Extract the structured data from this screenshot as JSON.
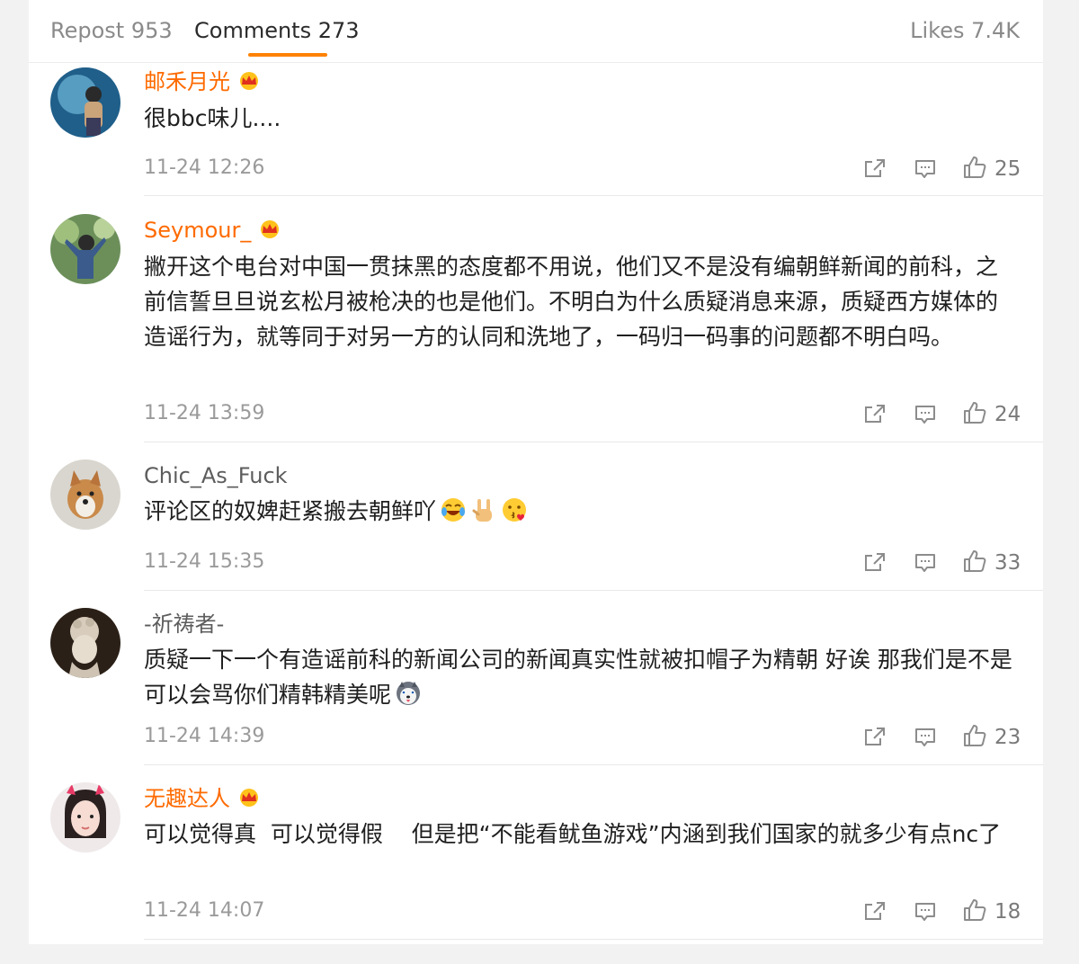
{
  "tabs": {
    "repost": "Repost 953",
    "comments": "Comments 273",
    "likes": "Likes 7.4K"
  },
  "colors": {
    "accent": "#ff8200",
    "vip_name": "#ff6a00",
    "plain_name": "#5d5d5d",
    "meta": "#9a9a9a"
  },
  "icons": {
    "share": "share-icon",
    "reply": "comment-icon",
    "like": "thumbs-up-icon",
    "badge": "vip-crown-icon"
  },
  "comments": [
    {
      "user": "邮禾月光",
      "vip": true,
      "text": "很bbc味儿....",
      "time": "11-24 12:26",
      "likes": "25"
    },
    {
      "user": "Seymour_",
      "vip": true,
      "text": "撇开这个电台对中国一贯抹黑的态度都不用说，他们又不是没有编朝鲜新闻的前科，之前信誓旦旦说玄松月被枪决的也是他们。不明白为什么质疑消息来源，质疑西方媒体的造谣行为，就等同于对另一方的认同和洗地了，一码归一码事的问题都不明白吗。",
      "time": "11-24 13:59",
      "likes": "24"
    },
    {
      "user": "Chic_As_Fuck",
      "vip": false,
      "text": "评论区的奴婢赶紧搬去朝鲜吖",
      "emojis": [
        "laughing-crying-emoji",
        "rock-hand-emoji",
        "kissing-face-emoji"
      ],
      "time": "11-24 15:35",
      "likes": "33"
    },
    {
      "user": "-祈祷者-",
      "vip": false,
      "text": "质疑一下一个有造谣前科的新闻公司的新闻真实性就被扣帽子为精朝 好诶 那我们是不是可以会骂你们精韩精美呢",
      "emojis": [
        "husky-dog-emoji"
      ],
      "time": "11-24 14:39",
      "likes": "23"
    },
    {
      "user": "无趣达人",
      "vip": true,
      "text": "可以觉得真  可以觉得假    但是把“不能看鱿鱼游戏”内涵到我们国家的就多少有点nc了",
      "time": "11-24 14:07",
      "likes": "18"
    }
  ]
}
